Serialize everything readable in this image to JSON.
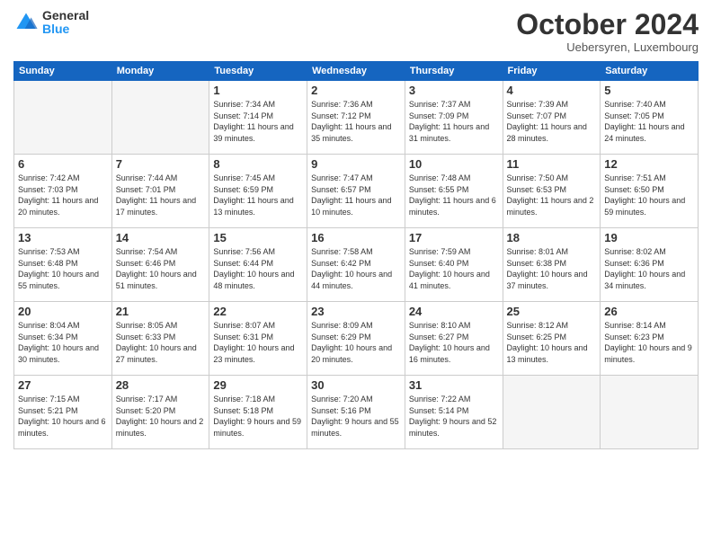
{
  "logo": {
    "general": "General",
    "blue": "Blue"
  },
  "title": "October 2024",
  "subtitle": "Uebersyren, Luxembourg",
  "days_of_week": [
    "Sunday",
    "Monday",
    "Tuesday",
    "Wednesday",
    "Thursday",
    "Friday",
    "Saturday"
  ],
  "weeks": [
    [
      {
        "day": "",
        "info": ""
      },
      {
        "day": "",
        "info": ""
      },
      {
        "day": "1",
        "info": "Sunrise: 7:34 AM\nSunset: 7:14 PM\nDaylight: 11 hours and 39 minutes."
      },
      {
        "day": "2",
        "info": "Sunrise: 7:36 AM\nSunset: 7:12 PM\nDaylight: 11 hours and 35 minutes."
      },
      {
        "day": "3",
        "info": "Sunrise: 7:37 AM\nSunset: 7:09 PM\nDaylight: 11 hours and 31 minutes."
      },
      {
        "day": "4",
        "info": "Sunrise: 7:39 AM\nSunset: 7:07 PM\nDaylight: 11 hours and 28 minutes."
      },
      {
        "day": "5",
        "info": "Sunrise: 7:40 AM\nSunset: 7:05 PM\nDaylight: 11 hours and 24 minutes."
      }
    ],
    [
      {
        "day": "6",
        "info": "Sunrise: 7:42 AM\nSunset: 7:03 PM\nDaylight: 11 hours and 20 minutes."
      },
      {
        "day": "7",
        "info": "Sunrise: 7:44 AM\nSunset: 7:01 PM\nDaylight: 11 hours and 17 minutes."
      },
      {
        "day": "8",
        "info": "Sunrise: 7:45 AM\nSunset: 6:59 PM\nDaylight: 11 hours and 13 minutes."
      },
      {
        "day": "9",
        "info": "Sunrise: 7:47 AM\nSunset: 6:57 PM\nDaylight: 11 hours and 10 minutes."
      },
      {
        "day": "10",
        "info": "Sunrise: 7:48 AM\nSunset: 6:55 PM\nDaylight: 11 hours and 6 minutes."
      },
      {
        "day": "11",
        "info": "Sunrise: 7:50 AM\nSunset: 6:53 PM\nDaylight: 11 hours and 2 minutes."
      },
      {
        "day": "12",
        "info": "Sunrise: 7:51 AM\nSunset: 6:50 PM\nDaylight: 10 hours and 59 minutes."
      }
    ],
    [
      {
        "day": "13",
        "info": "Sunrise: 7:53 AM\nSunset: 6:48 PM\nDaylight: 10 hours and 55 minutes."
      },
      {
        "day": "14",
        "info": "Sunrise: 7:54 AM\nSunset: 6:46 PM\nDaylight: 10 hours and 51 minutes."
      },
      {
        "day": "15",
        "info": "Sunrise: 7:56 AM\nSunset: 6:44 PM\nDaylight: 10 hours and 48 minutes."
      },
      {
        "day": "16",
        "info": "Sunrise: 7:58 AM\nSunset: 6:42 PM\nDaylight: 10 hours and 44 minutes."
      },
      {
        "day": "17",
        "info": "Sunrise: 7:59 AM\nSunset: 6:40 PM\nDaylight: 10 hours and 41 minutes."
      },
      {
        "day": "18",
        "info": "Sunrise: 8:01 AM\nSunset: 6:38 PM\nDaylight: 10 hours and 37 minutes."
      },
      {
        "day": "19",
        "info": "Sunrise: 8:02 AM\nSunset: 6:36 PM\nDaylight: 10 hours and 34 minutes."
      }
    ],
    [
      {
        "day": "20",
        "info": "Sunrise: 8:04 AM\nSunset: 6:34 PM\nDaylight: 10 hours and 30 minutes."
      },
      {
        "day": "21",
        "info": "Sunrise: 8:05 AM\nSunset: 6:33 PM\nDaylight: 10 hours and 27 minutes."
      },
      {
        "day": "22",
        "info": "Sunrise: 8:07 AM\nSunset: 6:31 PM\nDaylight: 10 hours and 23 minutes."
      },
      {
        "day": "23",
        "info": "Sunrise: 8:09 AM\nSunset: 6:29 PM\nDaylight: 10 hours and 20 minutes."
      },
      {
        "day": "24",
        "info": "Sunrise: 8:10 AM\nSunset: 6:27 PM\nDaylight: 10 hours and 16 minutes."
      },
      {
        "day": "25",
        "info": "Sunrise: 8:12 AM\nSunset: 6:25 PM\nDaylight: 10 hours and 13 minutes."
      },
      {
        "day": "26",
        "info": "Sunrise: 8:14 AM\nSunset: 6:23 PM\nDaylight: 10 hours and 9 minutes."
      }
    ],
    [
      {
        "day": "27",
        "info": "Sunrise: 7:15 AM\nSunset: 5:21 PM\nDaylight: 10 hours and 6 minutes."
      },
      {
        "day": "28",
        "info": "Sunrise: 7:17 AM\nSunset: 5:20 PM\nDaylight: 10 hours and 2 minutes."
      },
      {
        "day": "29",
        "info": "Sunrise: 7:18 AM\nSunset: 5:18 PM\nDaylight: 9 hours and 59 minutes."
      },
      {
        "day": "30",
        "info": "Sunrise: 7:20 AM\nSunset: 5:16 PM\nDaylight: 9 hours and 55 minutes."
      },
      {
        "day": "31",
        "info": "Sunrise: 7:22 AM\nSunset: 5:14 PM\nDaylight: 9 hours and 52 minutes."
      },
      {
        "day": "",
        "info": ""
      },
      {
        "day": "",
        "info": ""
      }
    ]
  ]
}
